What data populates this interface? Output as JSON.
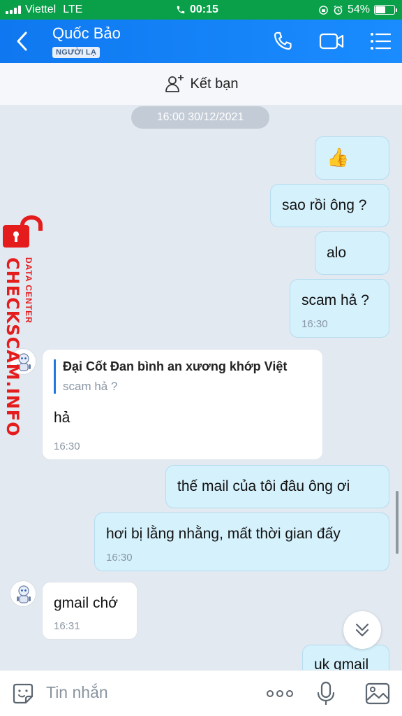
{
  "status_bar": {
    "carrier": "Viettel",
    "network": "LTE",
    "time": "00:15",
    "battery": "54%",
    "battery_level": 0.54
  },
  "header": {
    "contact_name": "Quốc Bảo",
    "badge": "NGƯỜI LẠ"
  },
  "add_friend": {
    "label": "Kết bạn"
  },
  "chat": {
    "date_separator": "16:00 30/12/2021",
    "messages": [
      {
        "side": "out",
        "text": "👍",
        "time": ""
      },
      {
        "side": "out",
        "text": "sao rồi ông ?",
        "time": ""
      },
      {
        "side": "out",
        "text": "alo",
        "time": ""
      },
      {
        "side": "out",
        "text": "scam hả ?",
        "time": "16:30"
      },
      {
        "side": "in",
        "reply_to_name": "Đại Cốt Đan bình an xương khớp Việt",
        "reply_to_text": "scam hả ?",
        "text": "hả",
        "time": "16:30"
      },
      {
        "side": "out",
        "text": "thế mail của tôi đâu ông ơi",
        "time": ""
      },
      {
        "side": "out",
        "text": "hơi bị lằng nhằng, mất thời gian đấy",
        "time": "16:30"
      },
      {
        "side": "in",
        "text": "gmail chớ",
        "time": "16:31"
      },
      {
        "side": "out",
        "text": "uk gmail",
        "time": ""
      }
    ]
  },
  "watermark": {
    "main": "CHECKSCAM.INFO",
    "sub": "DATA CENTER"
  },
  "input": {
    "placeholder": "Tin nhắn"
  }
}
